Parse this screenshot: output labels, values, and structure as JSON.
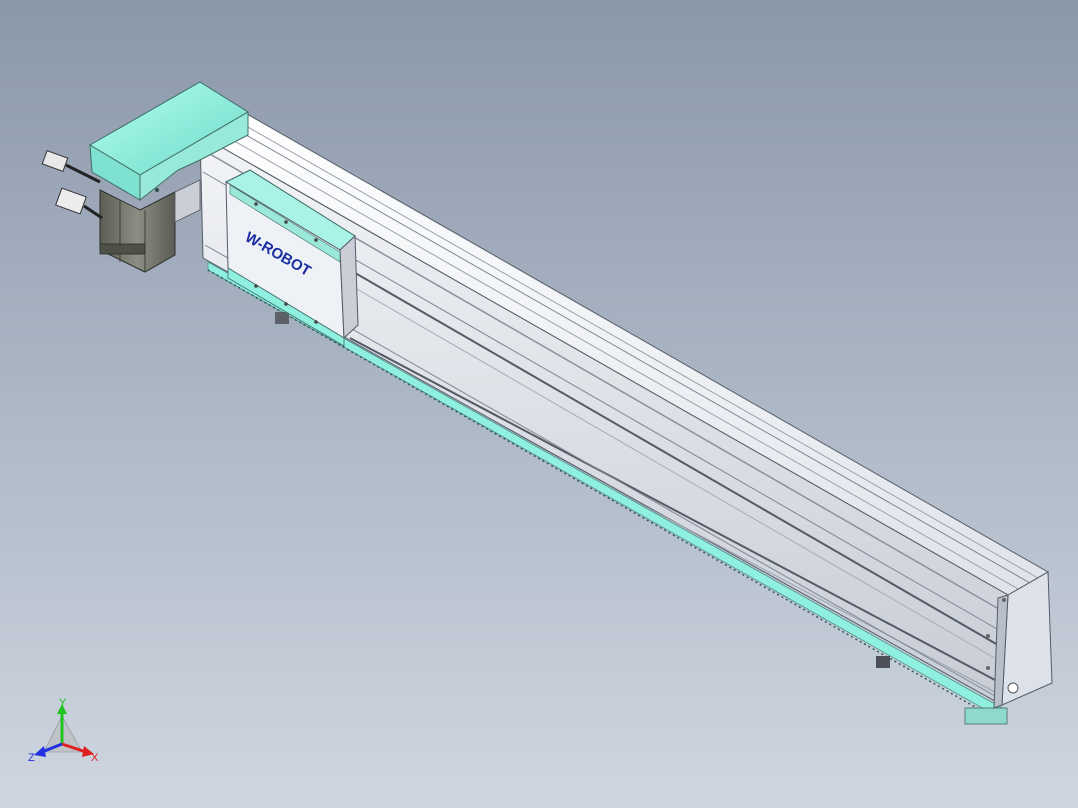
{
  "viewport": {
    "background_top": "#8b98aa",
    "background_bottom": "#cfd6e0"
  },
  "model": {
    "logo_text": "W-ROBOT",
    "colors": {
      "rail_body": "#d9dde4",
      "rail_dark": "#7d8594",
      "accent_mint": "#8ff0e0",
      "motor_dark": "#6d6f64",
      "logo_blue": "#1c2fa0"
    }
  },
  "triad": {
    "x_label": "X",
    "y_label": "Y",
    "z_label": "Z",
    "x_color": "#e02020",
    "y_color": "#1fc41f",
    "z_color": "#2030e0"
  }
}
